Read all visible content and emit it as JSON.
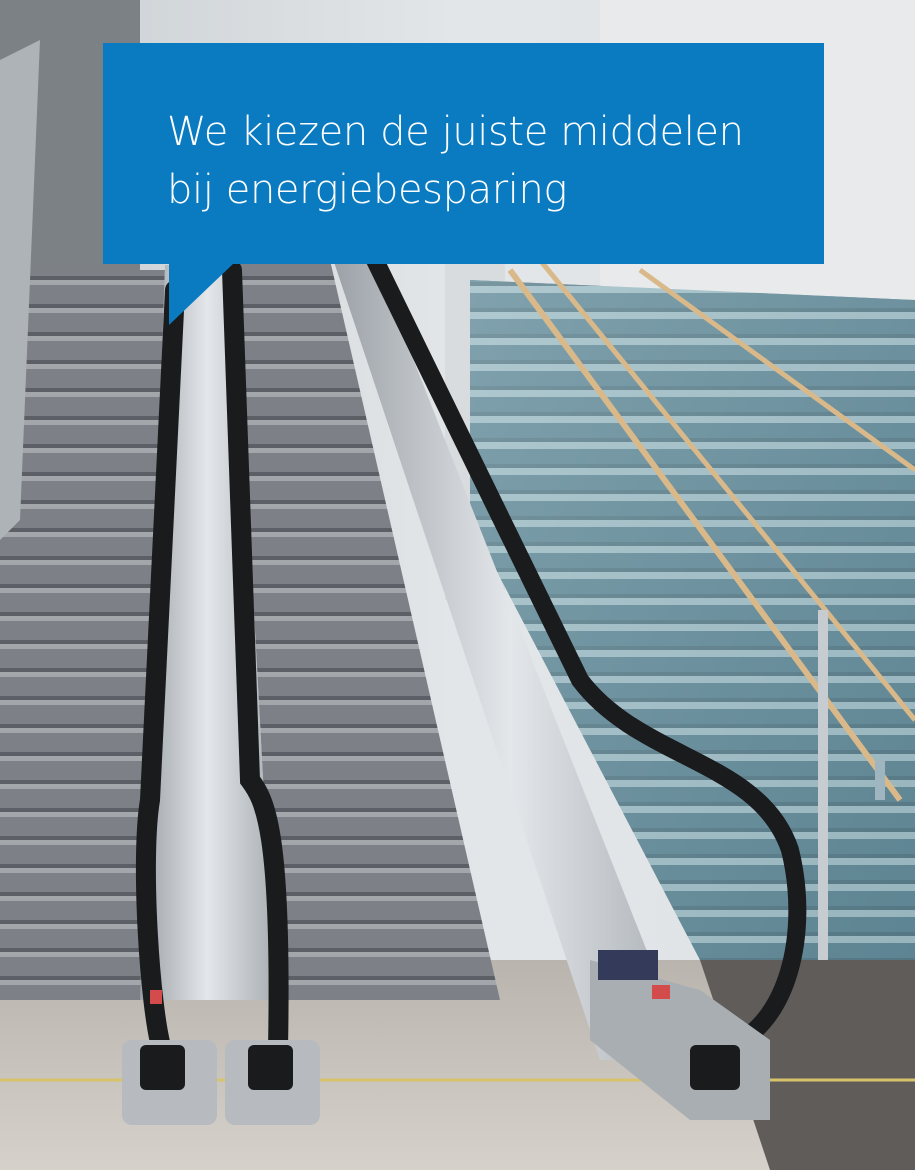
{
  "callout": {
    "line1": "We kiezen de juiste middelen",
    "line2": "bij energiebesparing",
    "background_color": "#0a7bc1",
    "text_color": "#ffffff"
  },
  "photo": {
    "subject": "escalator-and-glass-staircase"
  }
}
